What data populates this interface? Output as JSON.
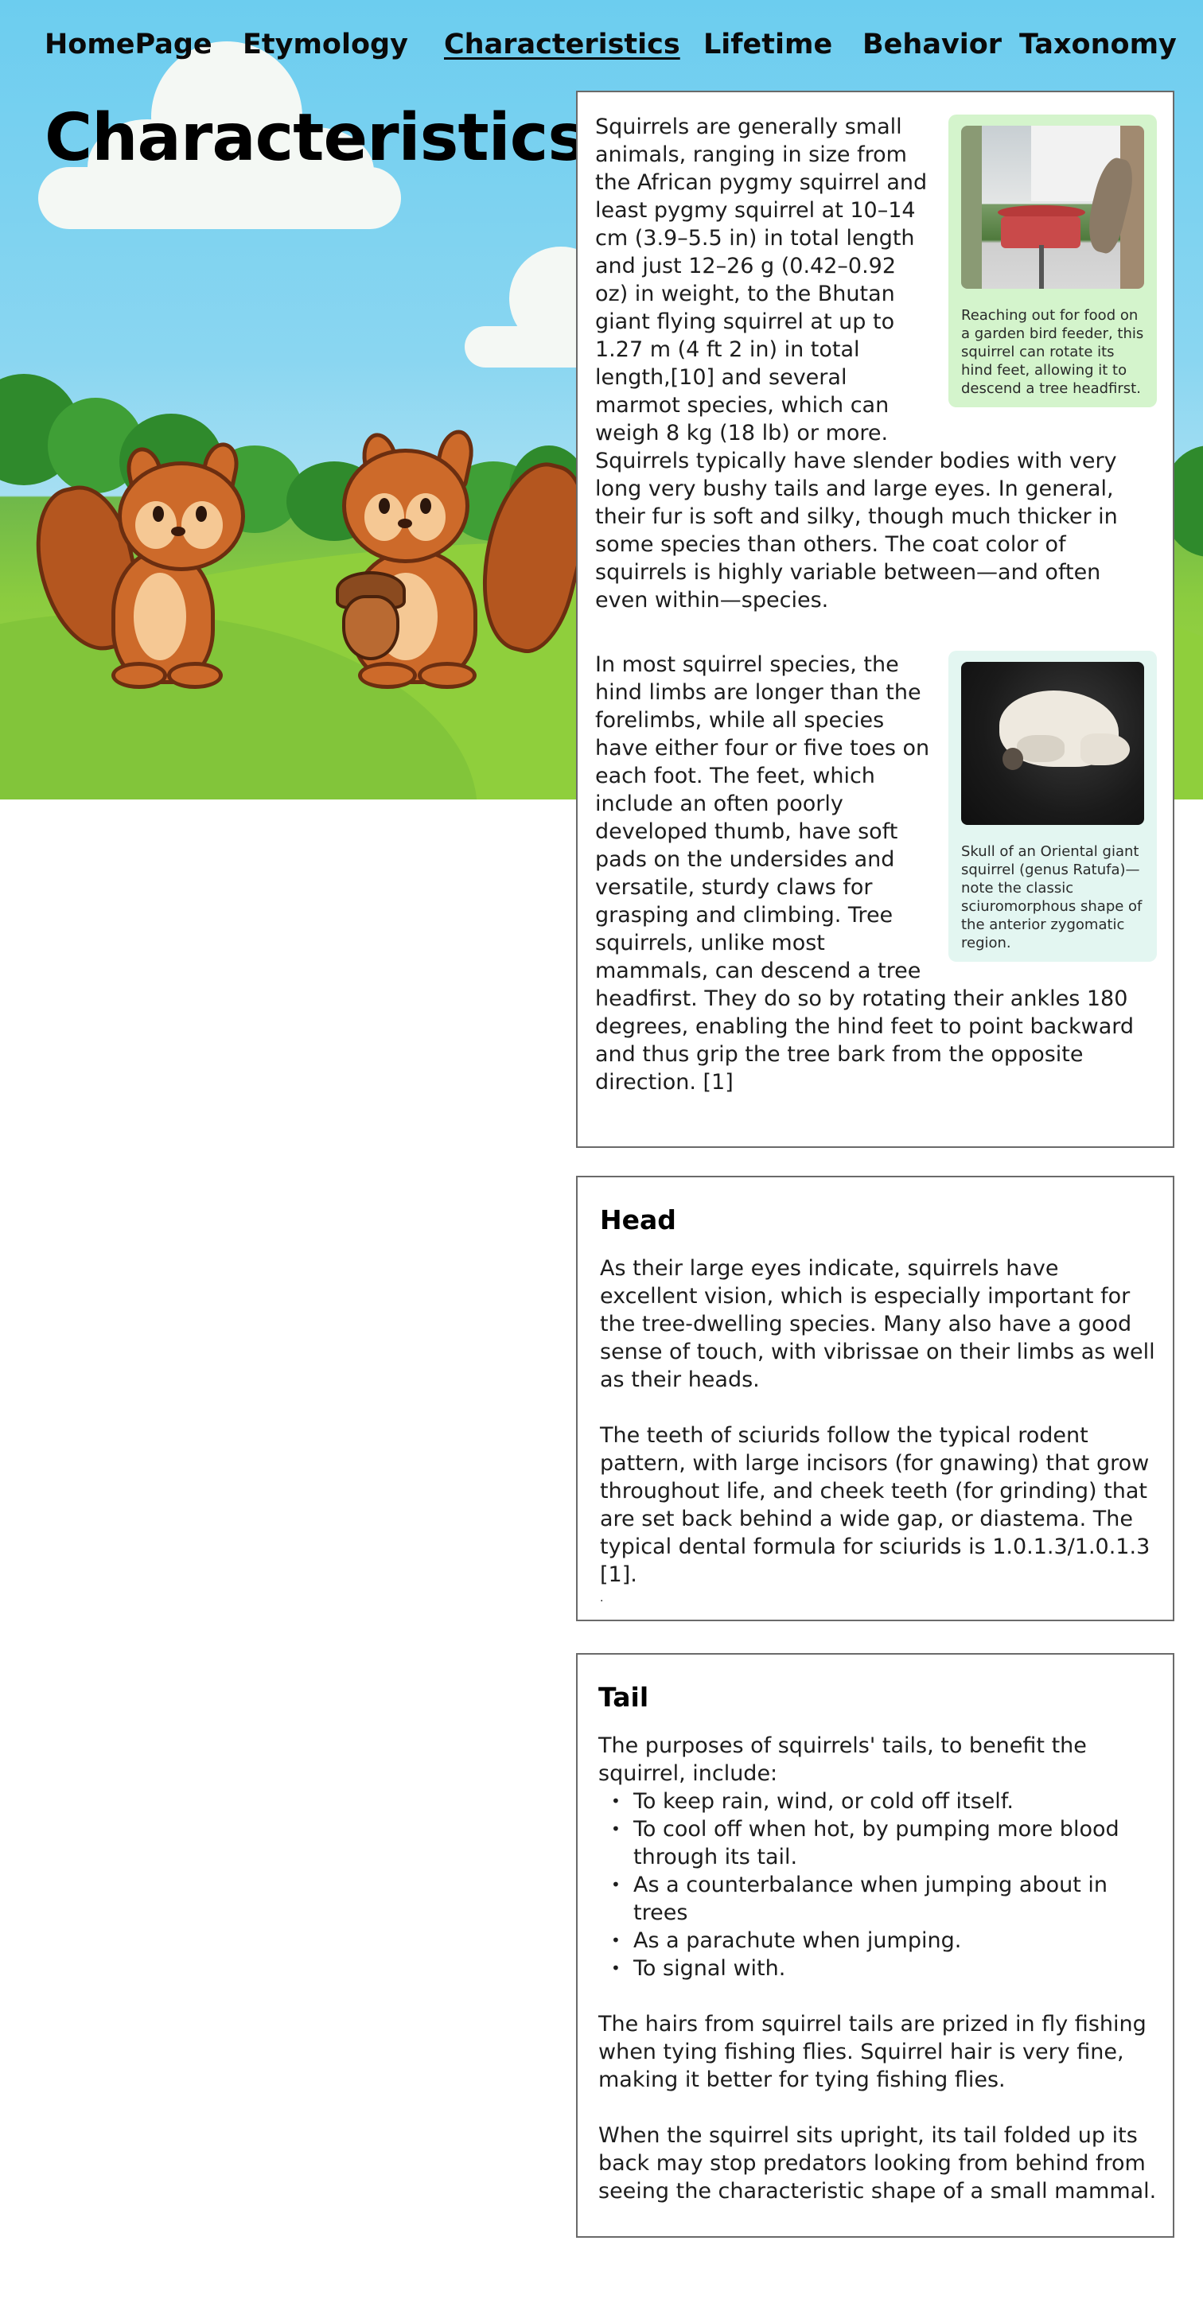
{
  "nav": {
    "items": [
      "HomePage",
      "Etymology",
      "Characteristics",
      "Lifetime",
      "Behavior",
      "Taxonomy"
    ],
    "active": "Characteristics"
  },
  "page_title": "Characteristics",
  "intro": {
    "figure_caption": "Reaching out for food on a garden bird feeder, this squirrel can rotate its hind feet, allowing it to descend a tree headfirst.",
    "paragraph_1": "Squirrels are generally small animals, ranging in size from the African pygmy squirrel and least pygmy squirrel at 10–14 cm (3.9–5.5 in) in total length and just 12–26 g (0.42–0.92 oz) in weight, to the Bhutan giant flying squirrel at up to 1.27 m (4 ft 2 in) in total length,[10] and several marmot species, which can weigh 8 kg (18 lb) or more.",
    "paragraph_2": "Squirrels typically have slender bodies with very long very bushy tails and large eyes. In general, their fur is soft and silky, though much thicker in some species than others. The coat color of squirrels is highly variable between—and often even within—species.",
    "skull_caption": "Skull of an Oriental giant squirrel (genus Ratufa)—note the classic sciuromorphous shape of the anterior zygomatic region.",
    "paragraph_3": "In most squirrel species, the hind limbs are longer than the forelimbs, while all species have either four or five toes on each foot. The feet, which include an often poorly developed thumb, have soft pads on the undersides and versatile, sturdy claws for grasping and climbing. Tree squirrels, unlike most mammals, can descend a tree headfirst. They do so by rotating their ankles 180 degrees, enabling the hind feet to point backward and thus grip the tree bark from the opposite direction. [1]"
  },
  "head": {
    "title": "Head",
    "paragraph_1": "As their large eyes indicate, squirrels have excellent vision, which is especially important for the tree-dwelling species. Many also have a good sense of touch, with vibrissae on their limbs as well as their heads.",
    "paragraph_2": "The teeth of sciurids follow the typical rodent pattern, with large incisors (for gnawing) that grow throughout life, and cheek teeth (for grinding) that are set back behind a wide gap, or diastema. The typical dental formula for sciurids is 1.0.1.3/1.0.1.3 [1].",
    "trailing": "."
  },
  "tail": {
    "title": "Tail",
    "intro": "The purposes of squirrels' tails, to benefit the squirrel, include:",
    "bullets": [
      "To keep rain, wind, or cold off itself.",
      "To cool off when hot, by pumping more blood through its tail.",
      "As a counterbalance when jumping about in trees",
      "As a parachute when jumping.",
      "To signal with."
    ],
    "paragraph_2": "The hairs from squirrel tails are prized in fly fishing when tying fishing flies. Squirrel hair is very fine, making it better for tying fishing flies.",
    "paragraph_3": "When the squirrel sits upright, its tail folded up its back may stop predators looking from behind from seeing the characteristic shape of a small mammal."
  },
  "colors": {
    "sky": "#6ccdef",
    "grass": "#8bcc3f",
    "figure_green": "#d4f4cc",
    "figure_mint": "#e3f6f1",
    "card_border": "#6a6a6a"
  }
}
